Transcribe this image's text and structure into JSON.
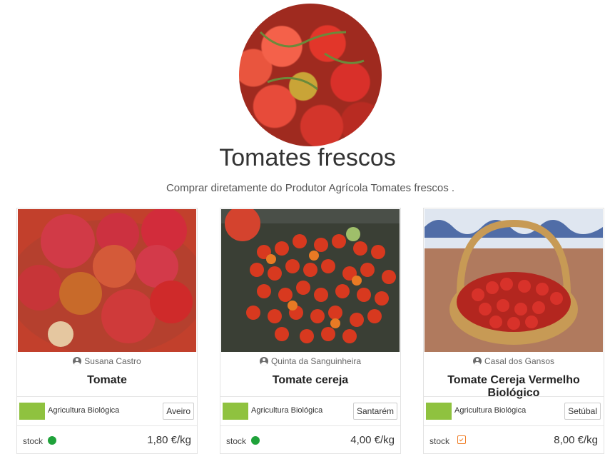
{
  "header": {
    "hero_image": "tomatoes-photo",
    "title": "Tomates frescos",
    "subtitle": "Comprar diretamente do Produtor Agrícola Tomates frescos ."
  },
  "products": [
    {
      "producer": "Susana Castro",
      "name": "Tomate",
      "certification": "Agricultura Biológica",
      "region": "Aveiro",
      "stock_label": "stock",
      "stock_icon": "stock-available-dot",
      "price": "1,80 €/kg"
    },
    {
      "producer": "Quinta da Sanguinheira",
      "name": "Tomate cereja",
      "certification": "Agricultura Biológica",
      "region": "Santarém",
      "stock_label": "stock",
      "stock_icon": "stock-available-dot",
      "price": "4,00 €/kg"
    },
    {
      "producer": "Casal dos Gansos",
      "name": "Tomate Cereja Vermelho Biológico",
      "certification": "Agricultura Biológica",
      "region": "Setúbal",
      "stock_label": "stock",
      "stock_icon": "calendar-check-icon",
      "price": "8,00 €/kg"
    }
  ],
  "colors": {
    "stock_available": "#1fa23a",
    "stock_scheduled": "#ef7b22",
    "organic_green": "#8fc23f"
  }
}
